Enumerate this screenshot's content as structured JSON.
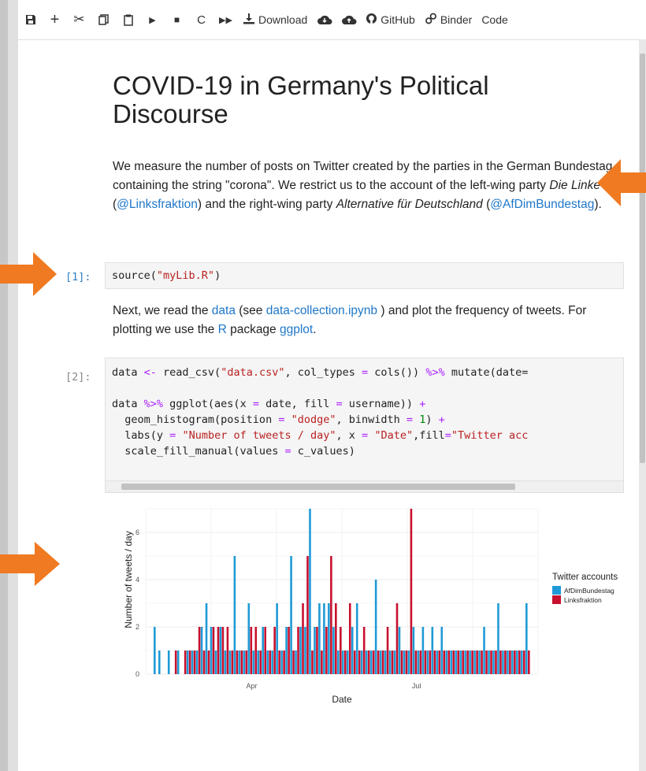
{
  "toolbar": {
    "buttons": [
      {
        "name": "save-icon",
        "glyph": "🖫"
      },
      {
        "name": "add-cell-icon",
        "glyph": "+"
      },
      {
        "name": "cut-icon",
        "glyph": "✂"
      },
      {
        "name": "copy-icon",
        "glyph": "⧉"
      },
      {
        "name": "paste-icon",
        "glyph": "📋"
      },
      {
        "name": "run-icon",
        "glyph": "▶"
      },
      {
        "name": "stop-icon",
        "glyph": "■"
      },
      {
        "name": "restart-icon",
        "glyph": "C"
      },
      {
        "name": "run-all-icon",
        "glyph": "⏩"
      }
    ],
    "download_label": "Download",
    "github_label": "GitHub",
    "binder_label": "Binder",
    "cell_type_label": "Code"
  },
  "notebook": {
    "title": "COVID-19 in Germany's Political Discourse",
    "intro": {
      "part1": "We measure the number of posts on Twitter created by the parties in the German Bundestag containing the string \"corona\". We restrict us to the account of the left-wing party ",
      "linke_name": "Die Linke",
      "part2": " (",
      "linke_handle": "@Linksfraktion",
      "part3": ") and the right-wing party ",
      "afd_name": "Alternative für Deutschland",
      "part4": " (",
      "afd_handle": "@AfDimBundestag",
      "part5": ")."
    },
    "cell1": {
      "prompt": "[1]:",
      "code_fn": "source(",
      "code_str": "\"myLib.R\"",
      "code_end": ")"
    },
    "next_para": {
      "p1": "Next, we read the ",
      "link_data": "data",
      "p2": " (see ",
      "link_collection": "data-collection.ipynb",
      "p3": " ) and plot the frequency of tweets. For plotting we use the ",
      "link_r": "R",
      "p4": " package ",
      "link_ggplot": "ggplot",
      "p5": "."
    },
    "cell2": {
      "prompt": "[2]:",
      "line1": [
        "data ",
        "<-",
        " read_csv(",
        "\"data.csv\"",
        ", col_types ",
        "=",
        " cols()) ",
        "%>%",
        " mutate(date="
      ],
      "line3": [
        "data ",
        "%>%",
        " ggplot(aes(x ",
        "=",
        " date, fill ",
        "=",
        " username)) ",
        "+"
      ],
      "line4": [
        "  geom_histogram(position ",
        "=",
        " ",
        "\"dodge\"",
        ", binwidth ",
        "=",
        " ",
        "1",
        ") ",
        "+"
      ],
      "line5": [
        "  labs(y ",
        "=",
        " ",
        "\"Number of tweets / day\"",
        ", x ",
        "=",
        " ",
        "\"Date\"",
        ",fill",
        "=",
        "\"Twitter acc"
      ],
      "line6": [
        "  scale_fill_manual(values ",
        "=",
        " c_values)"
      ]
    }
  },
  "chart_data": {
    "type": "bar",
    "ylabel": "Number of tweets / day",
    "xlabel": "Date",
    "x_ticks": [
      "Apr",
      "Jul"
    ],
    "y_ticks": [
      0,
      2,
      4,
      6
    ],
    "ylim": [
      0,
      7
    ],
    "legend_title": "Twitter accounts",
    "legend_position": "right",
    "grid": true,
    "colors": {
      "AfDimBundestag": "#1f9ad6",
      "Linksfraktion": "#c8102e"
    },
    "series": [
      {
        "name": "AfDimBundestag",
        "values": [
          2,
          1,
          0,
          1,
          0,
          1,
          0,
          1,
          1,
          1,
          2,
          3,
          2,
          1,
          2,
          1,
          1,
          5,
          1,
          1,
          3,
          1,
          1,
          2,
          1,
          1,
          3,
          1,
          2,
          5,
          1,
          2,
          2,
          7,
          2,
          3,
          3,
          3,
          2,
          1,
          1,
          1,
          2,
          3,
          1,
          1,
          1,
          4,
          1,
          1,
          1,
          1,
          2,
          1,
          1,
          2,
          1,
          2,
          1,
          2,
          1,
          2,
          1,
          1,
          1,
          1,
          1,
          1,
          1,
          1,
          2,
          1,
          1,
          3,
          1,
          1,
          1,
          1,
          1,
          3
        ]
      },
      {
        "name": "Linksfraktion",
        "values": [
          0,
          0,
          0,
          0,
          1,
          0,
          1,
          1,
          1,
          2,
          1,
          1,
          2,
          2,
          2,
          2,
          1,
          1,
          1,
          1,
          2,
          2,
          1,
          2,
          1,
          2,
          1,
          1,
          2,
          1,
          2,
          3,
          5,
          1,
          2,
          1,
          2,
          5,
          3,
          2,
          1,
          3,
          1,
          1,
          2,
          1,
          1,
          1,
          1,
          2,
          1,
          3,
          1,
          1,
          7,
          1,
          1,
          1,
          1,
          1,
          1,
          1,
          1,
          1,
          1,
          1,
          1,
          1,
          1,
          1,
          1,
          1,
          1,
          1,
          1,
          1,
          1,
          1,
          1,
          1
        ]
      }
    ]
  }
}
